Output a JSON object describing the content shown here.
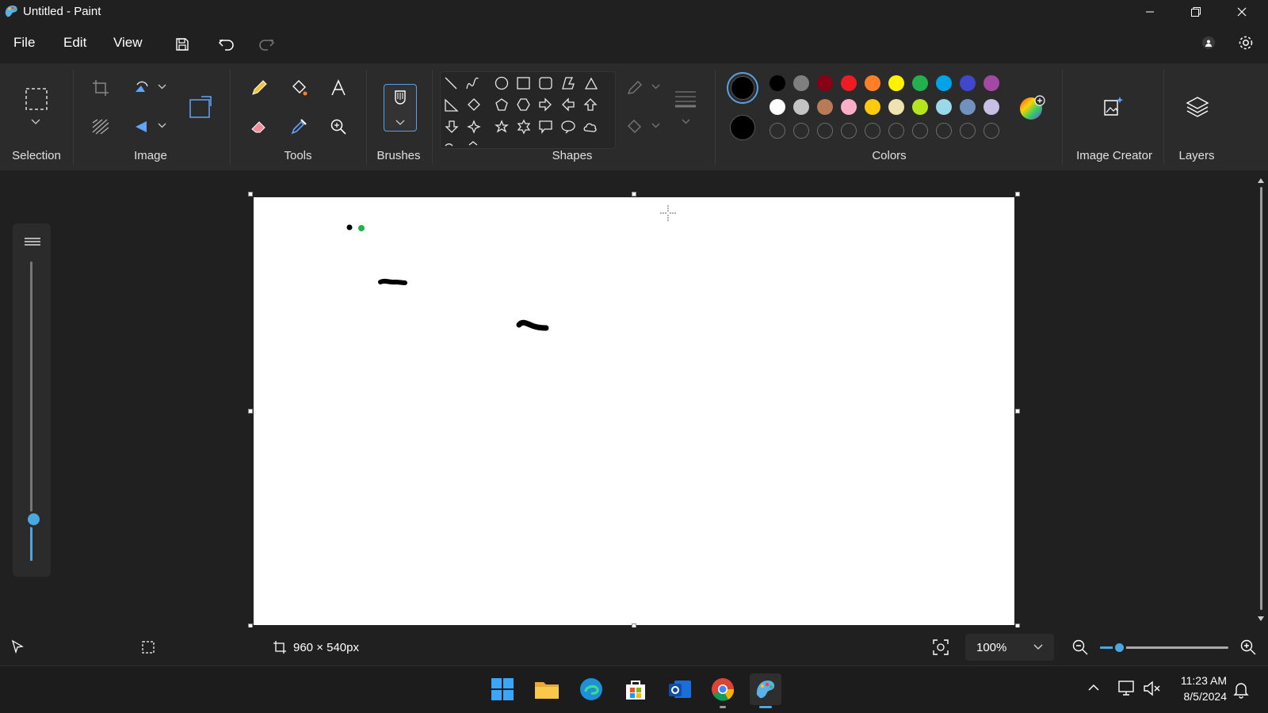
{
  "window": {
    "title": "Untitled - Paint"
  },
  "menu": {
    "file": "File",
    "edit": "Edit",
    "view": "View"
  },
  "ribbon": {
    "groups": {
      "selection": "Selection",
      "image": "Image",
      "tools": "Tools",
      "brushes": "Brushes",
      "shapes": "Shapes",
      "colors": "Colors",
      "image_creator": "Image Creator",
      "layers": "Layers"
    },
    "colors": {
      "primary": "#000000",
      "secondary": "#000000",
      "palette_row1": [
        "#000000",
        "#7f7f7f",
        "#880015",
        "#ed1c24",
        "#ff7f27",
        "#fff200",
        "#22b14c",
        "#00a2e8",
        "#3f48cc",
        "#a349a4"
      ],
      "palette_row2": [
        "#ffffff",
        "#c3c3c3",
        "#b97a57",
        "#ffaec9",
        "#ffc90e",
        "#efe4b0",
        "#b5e61d",
        "#99d9ea",
        "#7092be",
        "#c8bfe7"
      ],
      "custom_slots": 10
    }
  },
  "canvas": {
    "background": "#ffffff",
    "brush_size_level": 0.1
  },
  "status": {
    "canvas_size": "960 × 540px",
    "zoom": "100%",
    "zoom_level": 0.15
  },
  "taskbar": {
    "time": "11:23 AM",
    "date": "8/5/2024",
    "apps": [
      "windows-start-icon",
      "file-explorer-icon",
      "edge-icon",
      "store-icon",
      "outlook-icon",
      "chrome-icon",
      "paint-icon"
    ]
  }
}
